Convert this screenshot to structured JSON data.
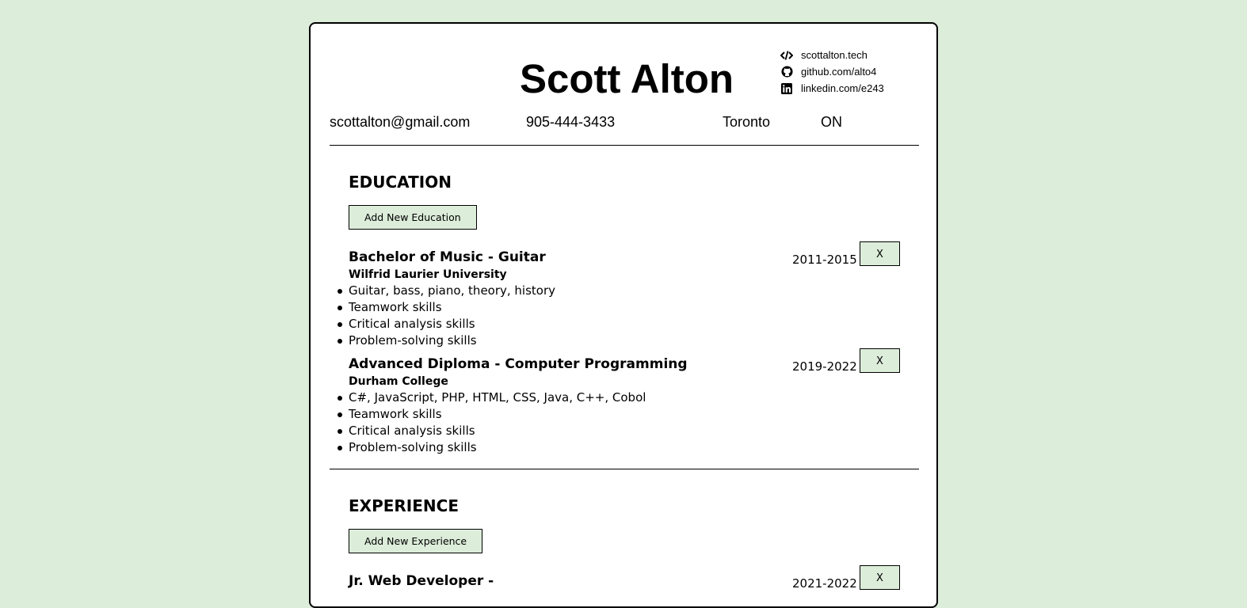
{
  "header": {
    "name": "Scott Alton",
    "links": [
      {
        "icon": "code-icon",
        "text": "scottalton.tech"
      },
      {
        "icon": "github-icon",
        "text": "github.com/alto4"
      },
      {
        "icon": "linkedin-icon",
        "text": "linkedin.com/e243"
      }
    ],
    "email": "scottalton@gmail.com",
    "phone": "905-444-3433",
    "city": "Toronto",
    "province": "ON"
  },
  "education": {
    "title": "EDUCATION",
    "add_label": "Add New Education",
    "entries": [
      {
        "degree": "Bachelor of Music - Guitar",
        "school": "Wilfrid Laurier University",
        "dates": "2011-2015",
        "remove_label": "X",
        "bullets": [
          "Guitar, bass, piano, theory, history",
          "Teamwork skills",
          "Critical analysis skills",
          "Problem-solving skills"
        ]
      },
      {
        "degree": "Advanced Diploma - Computer Programming",
        "school": "Durham College",
        "dates": "2019-2022",
        "remove_label": "X",
        "bullets": [
          "C#, JavaScript, PHP, HTML, CSS, Java, C++, Cobol",
          "Teamwork skills",
          "Critical analysis skills",
          "Problem-solving skills"
        ]
      }
    ]
  },
  "experience": {
    "title": "EXPERIENCE",
    "add_label": "Add New Experience",
    "entries": [
      {
        "role": "Jr. Web Developer -",
        "dates": "2021-2022",
        "remove_label": "X"
      }
    ]
  },
  "colors": {
    "background": "#dcedda",
    "button_bg": "#dcedda",
    "card": "#ffffff"
  }
}
